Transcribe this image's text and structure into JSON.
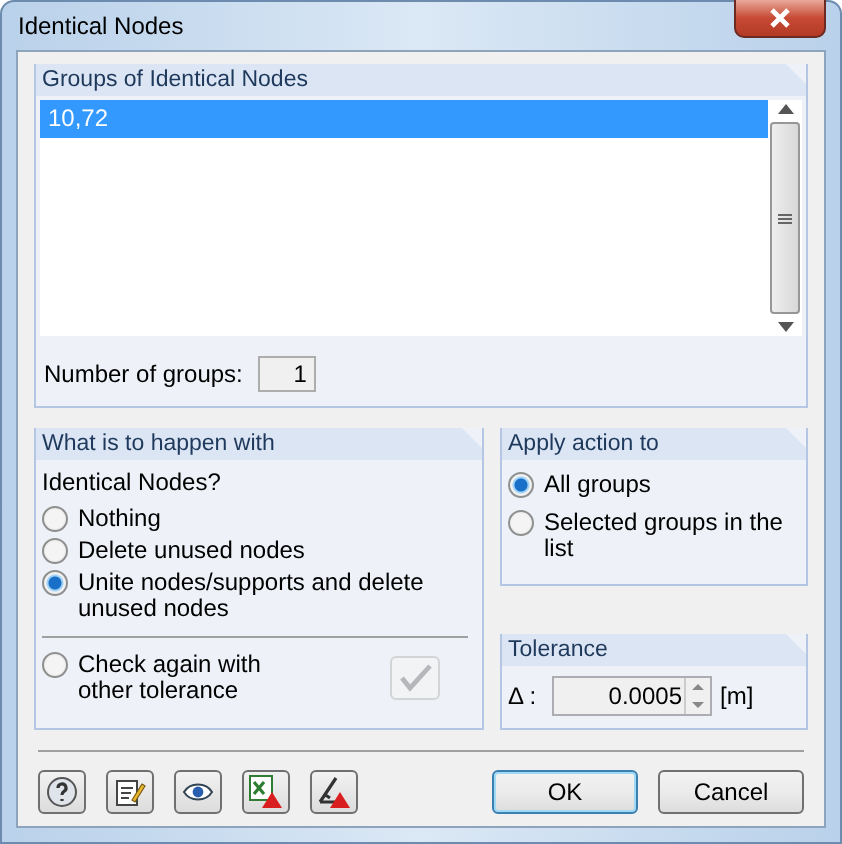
{
  "window": {
    "title": "Identical Nodes"
  },
  "groups": {
    "title": "Groups of Identical Nodes",
    "items": [
      {
        "text": "10,72",
        "selected": true
      }
    ],
    "count_label": "Number of groups:",
    "count": "1"
  },
  "happen": {
    "title": "What is to happen with",
    "prompt": "Identical Nodes?",
    "options": [
      {
        "label": "Nothing",
        "selected": false
      },
      {
        "label": "Delete unused nodes",
        "selected": false
      },
      {
        "label": "Unite nodes/supports and delete unused nodes",
        "selected": true
      }
    ],
    "recheck": {
      "label": "Check again with other tolerance",
      "selected": false,
      "button_disabled": true
    }
  },
  "apply": {
    "title": "Apply action to",
    "options": [
      {
        "label": "All groups",
        "selected": true
      },
      {
        "label": "Selected groups in the list",
        "selected": false
      }
    ]
  },
  "tolerance": {
    "title": "Tolerance",
    "symbol": "Δ :",
    "value": "0.0005",
    "unit": "[m]"
  },
  "tools": [
    {
      "kind": "help"
    },
    {
      "kind": "edit"
    },
    {
      "kind": "view"
    },
    {
      "kind": "excel"
    },
    {
      "kind": "measure"
    }
  ],
  "buttons": [
    {
      "label": "OK",
      "default": true
    },
    {
      "label": "Cancel",
      "default": false
    }
  ]
}
